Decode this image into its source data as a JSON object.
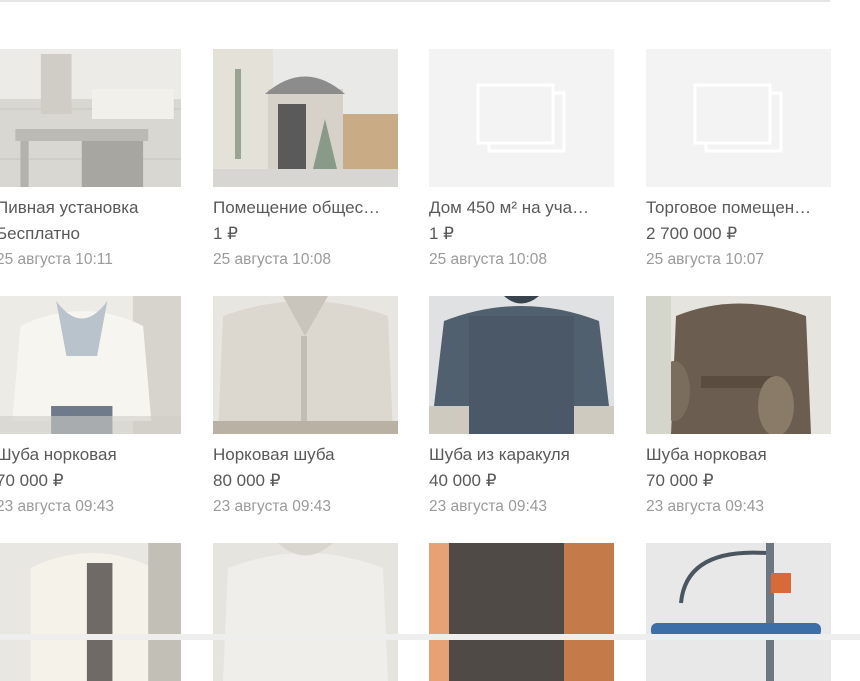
{
  "listings": [
    {
      "title": "Пивная установка",
      "price": "Бесплатно",
      "date": "25 августа 10:11",
      "image": "beer-equipment-photo"
    },
    {
      "title": "Помещение общес…",
      "price": "1 ₽",
      "date": "25 августа 10:08",
      "image": "building-entrance-photo"
    },
    {
      "title": "Дом 450 м² на уча…",
      "price": "1 ₽",
      "date": "25 августа 10:08",
      "image": "no-photo-placeholder"
    },
    {
      "title": "Торговое помещен…",
      "price": "2 700 000 ₽",
      "date": "25 августа 10:07",
      "image": "no-photo-placeholder"
    },
    {
      "title": "Шуба норковая",
      "price": "70 000 ₽",
      "date": "23 августа 09:43",
      "image": "white-fur-coat-photo"
    },
    {
      "title": "Норковая шуба",
      "price": "80 000 ₽",
      "date": "23 августа 09:43",
      "image": "light-mink-coat-photo"
    },
    {
      "title": "Шуба из каракуля",
      "price": "40 000 ₽",
      "date": "23 августа 09:43",
      "image": "dark-astrakhan-coat-photo"
    },
    {
      "title": "Шуба норковая",
      "price": "70 000 ₽",
      "date": "23 августа 09:43",
      "image": "brown-mink-coat-photo"
    },
    {
      "image": "cream-fur-coat-photo"
    },
    {
      "image": "white-fur-coat-photo"
    },
    {
      "image": "brown-leather-photo"
    },
    {
      "image": "ironing-equipment-photo"
    }
  ]
}
